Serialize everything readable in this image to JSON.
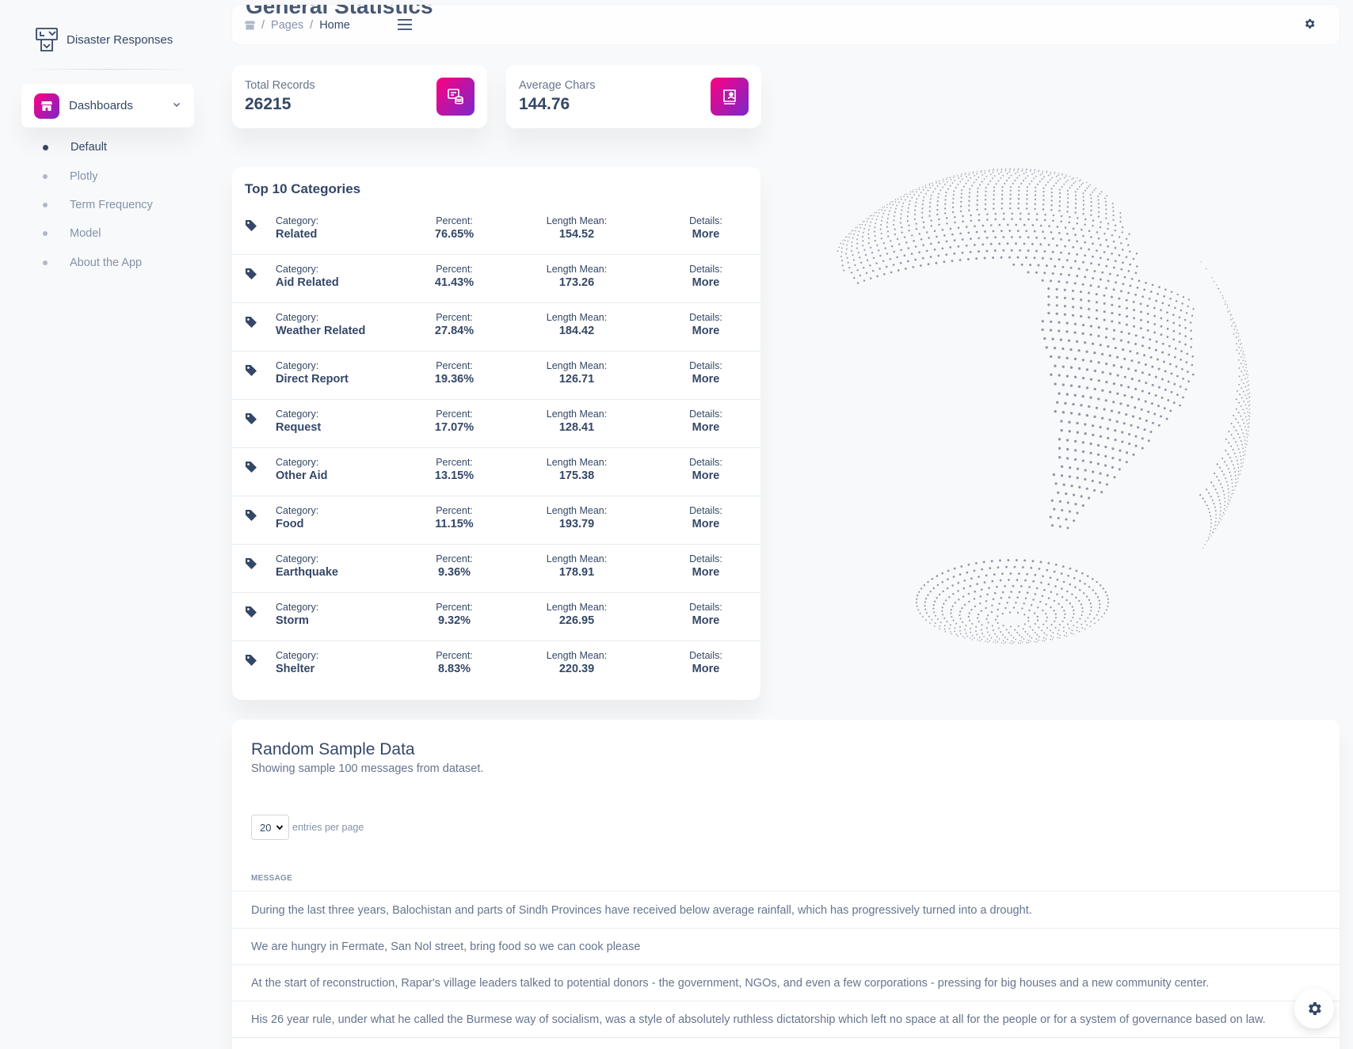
{
  "app": {
    "title": "Disaster Responses"
  },
  "sidebar": {
    "dashboards_label": "Dashboards",
    "items": [
      {
        "label": "Default",
        "active": true
      },
      {
        "label": "Plotly",
        "active": false
      },
      {
        "label": "Term Frequency",
        "active": false
      },
      {
        "label": "Model",
        "active": false
      },
      {
        "label": "About the App",
        "active": false
      }
    ]
  },
  "navbar": {
    "page_heading": "General Statistics",
    "breadcrumb": {
      "section": "Pages",
      "current": "Home"
    }
  },
  "stats": {
    "total_records": {
      "label": "Total Records",
      "value": "26215"
    },
    "average_chars": {
      "label": "Average Chars",
      "value": "144.76"
    }
  },
  "top_categories": {
    "title": "Top 10 Categories",
    "keys": {
      "category": "Category:",
      "percent": "Percent:",
      "length_mean": "Length Mean:",
      "details": "Details:"
    },
    "rows": [
      {
        "category": "Related",
        "percent": "76.65%",
        "length_mean": "154.52",
        "details": "More"
      },
      {
        "category": "Aid Related",
        "percent": "41.43%",
        "length_mean": "173.26",
        "details": "More"
      },
      {
        "category": "Weather Related",
        "percent": "27.84%",
        "length_mean": "184.42",
        "details": "More"
      },
      {
        "category": "Direct Report",
        "percent": "19.36%",
        "length_mean": "126.71",
        "details": "More"
      },
      {
        "category": "Request",
        "percent": "17.07%",
        "length_mean": "128.41",
        "details": "More"
      },
      {
        "category": "Other Aid",
        "percent": "13.15%",
        "length_mean": "175.38",
        "details": "More"
      },
      {
        "category": "Food",
        "percent": "11.15%",
        "length_mean": "193.79",
        "details": "More"
      },
      {
        "category": "Earthquake",
        "percent": "9.36%",
        "length_mean": "178.91",
        "details": "More"
      },
      {
        "category": "Storm",
        "percent": "9.32%",
        "length_mean": "226.95",
        "details": "More"
      },
      {
        "category": "Shelter",
        "percent": "8.83%",
        "length_mean": "220.39",
        "details": "More"
      }
    ]
  },
  "sample": {
    "title": "Random Sample Data",
    "subtitle": "Showing sample 100 messages from dataset.",
    "entries_value": "20",
    "entries_label": "entries per page",
    "column_header": "MESSAGE",
    "messages": [
      "During the last three years, Balochistan and parts of Sindh Provinces have received below average rainfall, which has progressively turned into a drought.",
      "We are hungry in Fermate, San Nol street, bring food so we can cook please",
      "At the start of reconstruction, Rapar's village leaders talked to potential donors - the government, NGOs, and even a few corporations - pressing for big houses and a new community center.",
      "His 26 year rule, under what he called the Burmese way of socialism, was a style of absolutely ruthless dictatorship which left no space at all for the people or for a system of governance based on law."
    ]
  },
  "colors": {
    "primary_text": "#344767",
    "muted_text": "#8392ab",
    "gradient_start": "#7928ca",
    "gradient_end": "#ff0080",
    "globe_dots": "#8f95a6"
  },
  "icons": {
    "brand": "mailbox-icon",
    "dashboards": "shop-icon",
    "breadcrumb_home": "shop-icon",
    "menu": "hamburger-icon",
    "settings": "gear-icon",
    "total_records": "database-icon",
    "average_chars": "user-board-icon",
    "category": "tag-icon"
  }
}
